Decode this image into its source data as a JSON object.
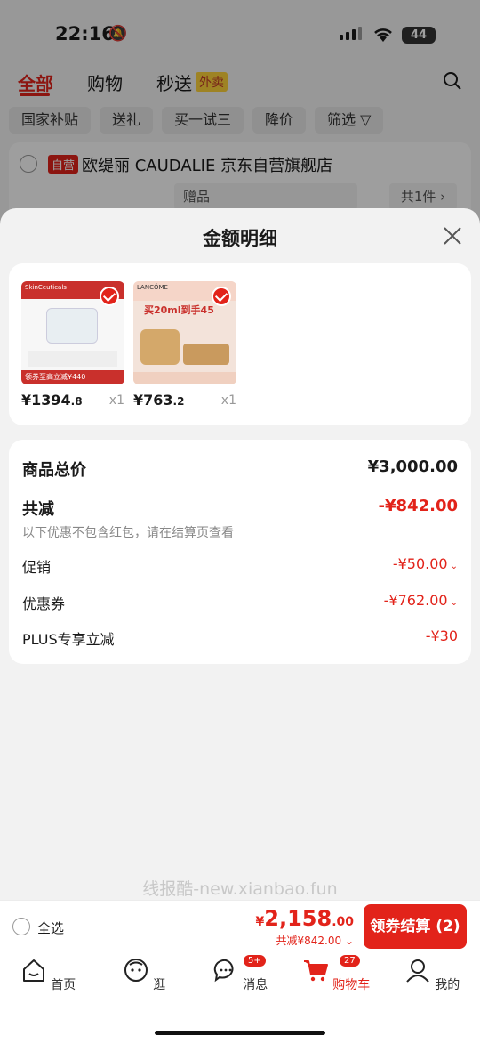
{
  "status": {
    "time": "22:16",
    "battery": "44"
  },
  "nav": {
    "tabs": [
      "全部",
      "购物",
      "秒送"
    ],
    "delivery_badge": "外卖"
  },
  "filters": [
    "国家补贴",
    "送礼",
    "买一试三",
    "降价",
    "筛选"
  ],
  "store": {
    "tag": "自营",
    "name": "欧缇丽 CAUDALIE 京东自营旗舰店",
    "gift_label": "赠品",
    "count": "共1件 ›"
  },
  "sheet": {
    "title": "金额明细",
    "products": [
      {
        "price": "¥1394",
        "price_dec": ".8",
        "qty": "x1",
        "brand": "SkinCeuticals",
        "promo": "领券至高立减¥440",
        "colors": {
          "top": "#c9302c",
          "body": "#f7f7f7"
        }
      },
      {
        "price": "¥763",
        "price_dec": ".2",
        "qty": "x1",
        "brand": "LANCÔME",
        "promo": "买20ml到手45",
        "colors": {
          "top": "#e6b9a8",
          "body": "#f3e3da"
        }
      }
    ],
    "summary": {
      "total_label": "商品总价",
      "total_value": "¥3,000.00",
      "reduce_label": "共减",
      "reduce_value": "-¥842.00",
      "note": "以下优惠不包含红包，请在结算页查看",
      "items": [
        {
          "label": "促销",
          "value": "-¥50.00",
          "expandable": true
        },
        {
          "label": "优惠券",
          "value": "-¥762.00",
          "expandable": true
        },
        {
          "label": "PLUS专享立减",
          "value": "-¥30",
          "expandable": false
        }
      ]
    }
  },
  "watermark": "线报酷-new.xianbao.fun",
  "checkout": {
    "select_all": "全选",
    "currency": "¥",
    "amount_int": "2,158",
    "amount_dec": ".00",
    "saved": "共减¥842.00",
    "button": "领券结算 (2)"
  },
  "tabbar": [
    {
      "label": "首页",
      "icon": "home-icon"
    },
    {
      "label": "逛",
      "icon": "face-icon"
    },
    {
      "label": "消息",
      "icon": "message-icon",
      "badge": "5+"
    },
    {
      "label": "购物车",
      "icon": "cart-icon",
      "badge": "27",
      "active": true
    },
    {
      "label": "我的",
      "icon": "profile-icon"
    }
  ],
  "colors": {
    "accent": "#e2231a"
  }
}
